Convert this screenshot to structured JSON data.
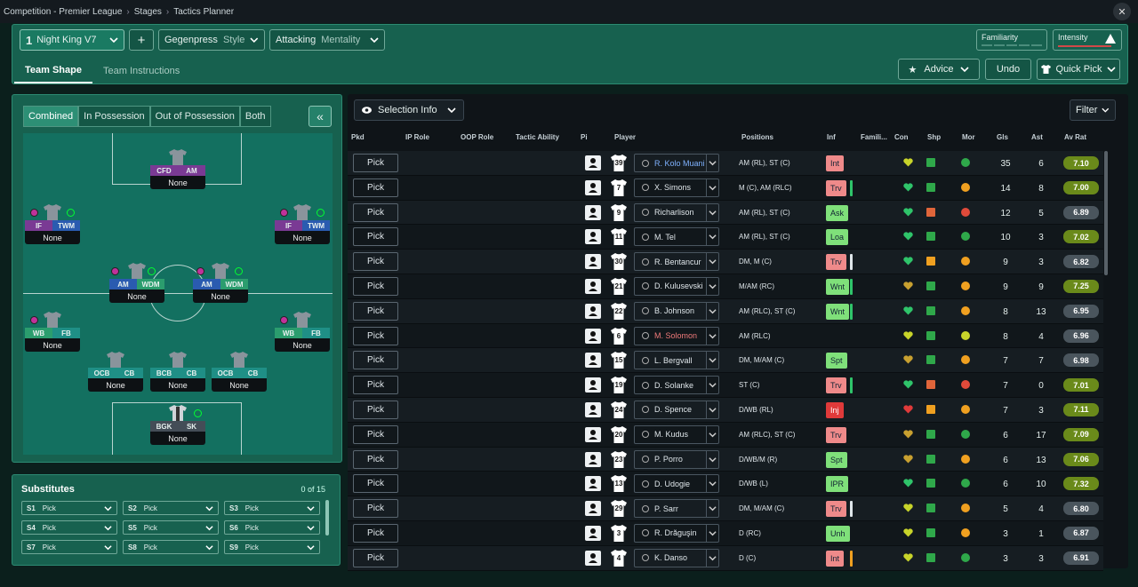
{
  "breadcrumb": {
    "items": [
      "Competition - Premier League",
      "Stages",
      "Tactics Planner"
    ]
  },
  "header": {
    "tactic": {
      "number": "1",
      "name": "Night King V7"
    },
    "add_label": "+",
    "style": {
      "value": "Gegenpress",
      "label": "Style"
    },
    "mentality": {
      "value": "Attacking",
      "label": "Mentality"
    },
    "familiarity_label": "Familiarity",
    "intensity_label": "Intensity",
    "tabs": [
      "Team Shape",
      "Team Instructions"
    ],
    "advice_label": "Advice",
    "undo_label": "Undo",
    "quick_pick_label": "Quick Pick"
  },
  "pitch": {
    "view_tabs": [
      "Combined",
      "In Possession",
      "Out of Possession",
      "Both"
    ],
    "collapse_label": "«",
    "slots": [
      {
        "roles": [
          "CFD",
          "AM"
        ],
        "label": "None"
      },
      {
        "roles": [
          "IF",
          "TWM"
        ],
        "label": "None"
      },
      {
        "roles": [
          "IF",
          "TWM"
        ],
        "label": "None"
      },
      {
        "roles": [
          "AM",
          "WDM"
        ],
        "label": "None"
      },
      {
        "roles": [
          "AM",
          "WDM"
        ],
        "label": "None"
      },
      {
        "roles": [
          "WB",
          "FB"
        ],
        "label": "None"
      },
      {
        "roles": [
          "WB",
          "FB"
        ],
        "label": "None"
      },
      {
        "roles": [
          "OCB",
          "CB"
        ],
        "label": "None"
      },
      {
        "roles": [
          "BCB",
          "CB"
        ],
        "label": "None"
      },
      {
        "roles": [
          "OCB",
          "CB"
        ],
        "label": "None"
      },
      {
        "roles": [
          "BGK",
          "SK"
        ],
        "label": "None"
      }
    ]
  },
  "substitutes": {
    "title": "Substitutes",
    "count": "0 of 15",
    "slots": [
      {
        "code": "S1",
        "value": "Pick"
      },
      {
        "code": "S2",
        "value": "Pick"
      },
      {
        "code": "S3",
        "value": "Pick"
      },
      {
        "code": "S4",
        "value": "Pick"
      },
      {
        "code": "S5",
        "value": "Pick"
      },
      {
        "code": "S6",
        "value": "Pick"
      },
      {
        "code": "S7",
        "value": "Pick"
      },
      {
        "code": "S8",
        "value": "Pick"
      },
      {
        "code": "S9",
        "value": "Pick"
      }
    ]
  },
  "selection": {
    "info_label": "Selection Info",
    "filter_label": "Filter",
    "columns": [
      "Pkd",
      "IP Role",
      "OOP Role",
      "Tactic Ability",
      "Pi",
      "Player",
      "Positions",
      "Inf",
      "Famili...",
      "Con",
      "Shp",
      "Mor",
      "Gls",
      "Ast",
      "Av Rat"
    ],
    "pick_label": "Pick",
    "rows": [
      {
        "num": "39",
        "name": "R. Kolo Muani",
        "name_color": "#7fb2ff",
        "pos": "AM (RL), ST (C)",
        "inf": "Int",
        "inf_style": "pk",
        "bar": "",
        "con": "#c8d42a",
        "shp": "#2fa84a",
        "mor": "#2fa84a",
        "gls": "35",
        "ast": "6",
        "rat": "7.10",
        "rat_style": "hi"
      },
      {
        "num": "7",
        "name": "X. Simons",
        "name_color": "#dfe6ea",
        "pos": "M (C), AM (RLC)",
        "inf": "Trv",
        "inf_style": "pk",
        "bar": "#2fc46a",
        "con": "#2fc46a",
        "shp": "#2fa84a",
        "mor": "#f0a020",
        "gls": "14",
        "ast": "8",
        "rat": "7.00",
        "rat_style": "hi"
      },
      {
        "num": "9",
        "name": "Richarlison",
        "name_color": "#dfe6ea",
        "pos": "AM (RL), ST (C)",
        "inf": "Ask",
        "inf_style": "gr",
        "bar": "",
        "con": "#2fc46a",
        "shp": "#e0653a",
        "mor": "#e04a3a",
        "gls": "12",
        "ast": "5",
        "rat": "6.89",
        "rat_style": "md"
      },
      {
        "num": "11",
        "name": "M. Tel",
        "name_color": "#dfe6ea",
        "pos": "AM (RL), ST (C)",
        "inf": "Loa",
        "inf_style": "gr",
        "bar": "",
        "con": "#2fc46a",
        "shp": "#2fa84a",
        "mor": "#2fa84a",
        "gls": "10",
        "ast": "3",
        "rat": "7.02",
        "rat_style": "hi"
      },
      {
        "num": "30",
        "name": "R. Bentancur",
        "name_color": "#dfe6ea",
        "pos": "DM, M (C)",
        "inf": "Trv",
        "inf_style": "pk",
        "bar": "#dfe6ea",
        "con": "#2fc46a",
        "shp": "#f0a020",
        "mor": "#f0a020",
        "gls": "9",
        "ast": "3",
        "rat": "6.82",
        "rat_style": "md"
      },
      {
        "num": "21",
        "name": "D. Kulusevski",
        "name_color": "#dfe6ea",
        "pos": "M/AM (RC)",
        "inf": "Wnt",
        "inf_style": "gr",
        "bar": "#2fc46a",
        "con": "#c8a030",
        "shp": "#2fa84a",
        "mor": "#f0a020",
        "gls": "9",
        "ast": "9",
        "rat": "7.25",
        "rat_style": "hi"
      },
      {
        "num": "22",
        "name": "B. Johnson",
        "name_color": "#dfe6ea",
        "pos": "AM (RLC), ST (C)",
        "inf": "Wnt",
        "inf_style": "gr",
        "bar": "#2fc46a",
        "con": "#2fc46a",
        "shp": "#2fa84a",
        "mor": "#f0a020",
        "gls": "8",
        "ast": "13",
        "rat": "6.95",
        "rat_style": "md"
      },
      {
        "num": "6",
        "name": "M. Solomon",
        "name_color": "#f07a7a",
        "pos": "AM (RLC)",
        "inf": "",
        "inf_style": "",
        "bar": "",
        "con": "#c8d42a",
        "shp": "#2fa84a",
        "mor": "#c8d42a",
        "gls": "8",
        "ast": "4",
        "rat": "6.96",
        "rat_style": "md"
      },
      {
        "num": "15",
        "name": "L. Bergvall",
        "name_color": "#dfe6ea",
        "pos": "DM, M/AM (C)",
        "inf": "Spt",
        "inf_style": "gr",
        "bar": "",
        "con": "#c8a030",
        "shp": "#2fa84a",
        "mor": "#f0a020",
        "gls": "7",
        "ast": "7",
        "rat": "6.98",
        "rat_style": "md"
      },
      {
        "num": "19",
        "name": "D. Solanke",
        "name_color": "#dfe6ea",
        "pos": "ST (C)",
        "inf": "Trv",
        "inf_style": "pk",
        "bar": "#2fc46a",
        "con": "#2fc46a",
        "shp": "#e0653a",
        "mor": "#e04a3a",
        "gls": "7",
        "ast": "0",
        "rat": "7.01",
        "rat_style": "hi"
      },
      {
        "num": "24",
        "name": "D. Spence",
        "name_color": "#dfe6ea",
        "pos": "D/WB (RL)",
        "inf": "Inj",
        "inf_style": "rd",
        "bar": "",
        "con": "#e03a3a",
        "shp": "#f0a020",
        "mor": "#f0a020",
        "gls": "7",
        "ast": "3",
        "rat": "7.11",
        "rat_style": "hi"
      },
      {
        "num": "20",
        "name": "M. Kudus",
        "name_color": "#dfe6ea",
        "pos": "AM (RLC), ST (C)",
        "inf": "Trv",
        "inf_style": "pk",
        "bar": "",
        "con": "#c8a030",
        "shp": "#2fa84a",
        "mor": "#2fa84a",
        "gls": "6",
        "ast": "17",
        "rat": "7.09",
        "rat_style": "hi"
      },
      {
        "num": "23",
        "name": "P. Porro",
        "name_color": "#dfe6ea",
        "pos": "D/WB/M (R)",
        "inf": "Spt",
        "inf_style": "gr",
        "bar": "",
        "con": "#c8a030",
        "shp": "#2fa84a",
        "mor": "#f0a020",
        "gls": "6",
        "ast": "13",
        "rat": "7.06",
        "rat_style": "hi"
      },
      {
        "num": "13",
        "name": "D. Udogie",
        "name_color": "#dfe6ea",
        "pos": "D/WB (L)",
        "inf": "IPR",
        "inf_style": "gr",
        "bar": "",
        "con": "#2fc46a",
        "shp": "#2fa84a",
        "mor": "#2fa84a",
        "gls": "6",
        "ast": "10",
        "rat": "7.32",
        "rat_style": "hi"
      },
      {
        "num": "29",
        "name": "P. Sarr",
        "name_color": "#dfe6ea",
        "pos": "DM, M/AM (C)",
        "inf": "Trv",
        "inf_style": "pk",
        "bar": "#dfe6ea",
        "con": "#c8d42a",
        "shp": "#2fa84a",
        "mor": "#f0a020",
        "gls": "5",
        "ast": "4",
        "rat": "6.80",
        "rat_style": "md"
      },
      {
        "num": "3",
        "name": "R. Drăguşin",
        "name_color": "#dfe6ea",
        "pos": "D (RC)",
        "inf": "Unh",
        "inf_style": "gr",
        "bar": "",
        "con": "#c8d42a",
        "shp": "#2fa84a",
        "mor": "#f0a020",
        "gls": "3",
        "ast": "1",
        "rat": "6.87",
        "rat_style": "md"
      },
      {
        "num": "4",
        "name": "K. Danso",
        "name_color": "#dfe6ea",
        "pos": "D (C)",
        "inf": "Int",
        "inf_style": "pk",
        "bar": "#f0a020",
        "con": "#c8d42a",
        "shp": "#2fa84a",
        "mor": "#2fa84a",
        "gls": "3",
        "ast": "3",
        "rat": "6.91",
        "rat_style": "md"
      }
    ]
  }
}
